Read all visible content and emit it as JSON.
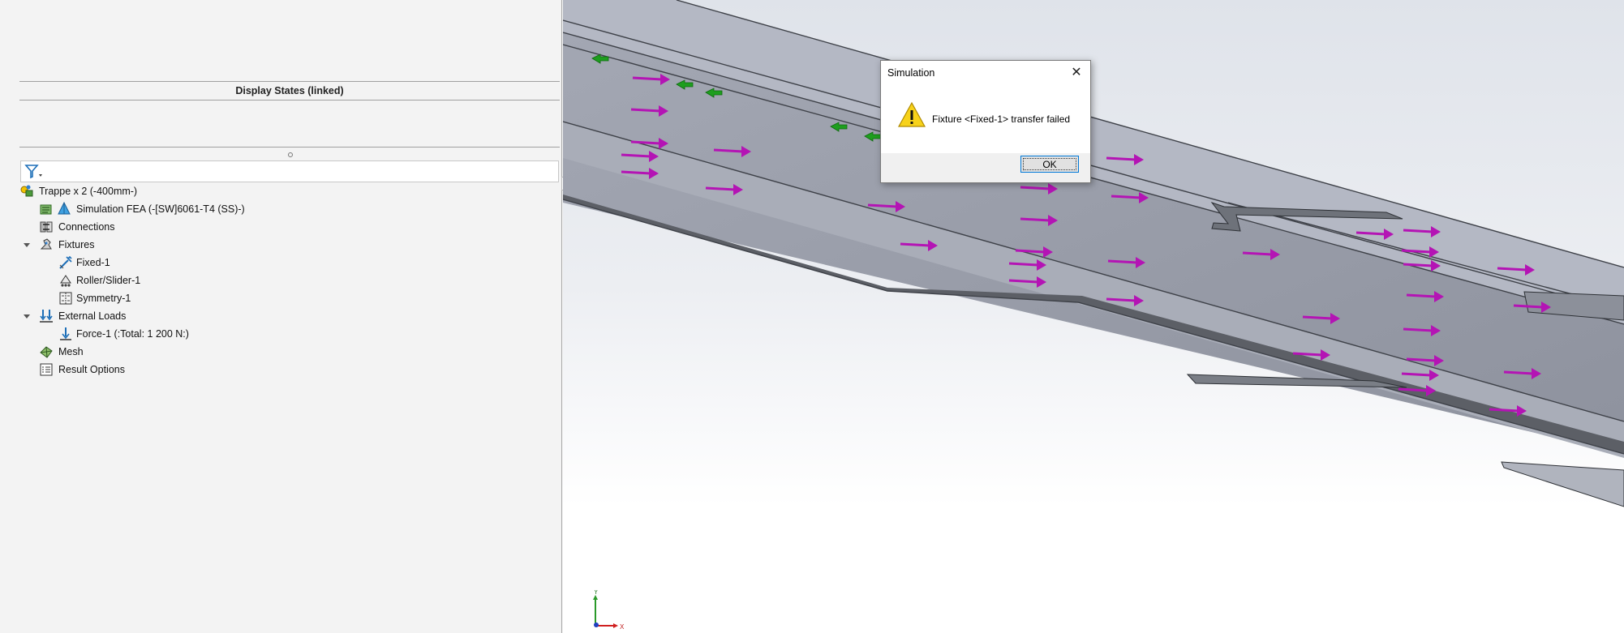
{
  "feature_manager": {
    "display_states_title": "Display States (linked)",
    "tree": [
      {
        "label": "Trappe x 2 (-400mm-)",
        "icon": "part-assembly-icon",
        "level": 0
      },
      {
        "label": "Simulation FEA (-[SW]6061-T4 (SS)-)",
        "icon": "simulation-material-icon",
        "level": 1
      },
      {
        "label": "Connections",
        "icon": "connections-icon",
        "level": 1
      },
      {
        "label": "Fixtures",
        "icon": "fixtures-icon",
        "level": 1,
        "expanded": true
      },
      {
        "label": "Fixed-1",
        "icon": "fixed-geometry-icon",
        "level": 2
      },
      {
        "label": "Roller/Slider-1",
        "icon": "roller-slider-icon",
        "level": 2
      },
      {
        "label": "Symmetry-1",
        "icon": "symmetry-icon",
        "level": 2
      },
      {
        "label": "External Loads",
        "icon": "external-loads-icon",
        "level": 1,
        "expanded": true
      },
      {
        "label": "Force-1 (:Total: 1 200 N:)",
        "icon": "force-icon",
        "level": 2
      },
      {
        "label": "Mesh",
        "icon": "mesh-icon",
        "level": 1
      },
      {
        "label": "Result Options",
        "icon": "result-options-icon",
        "level": 1
      }
    ]
  },
  "dialog": {
    "title": "Simulation",
    "message": "Fixture <Fixed-1> transfer failed",
    "ok_label": "OK",
    "close_glyph": "✕",
    "icon": "warning-icon"
  },
  "triad": {
    "y_label": "Y",
    "x_label": "X"
  },
  "colors": {
    "force_arrow": "#b414b4",
    "fixture_arrow": "#1e9e1e",
    "model_face": "#9da1ad",
    "dialog_border": "#7a7a7a",
    "ok_button_border": "#0078d7"
  }
}
